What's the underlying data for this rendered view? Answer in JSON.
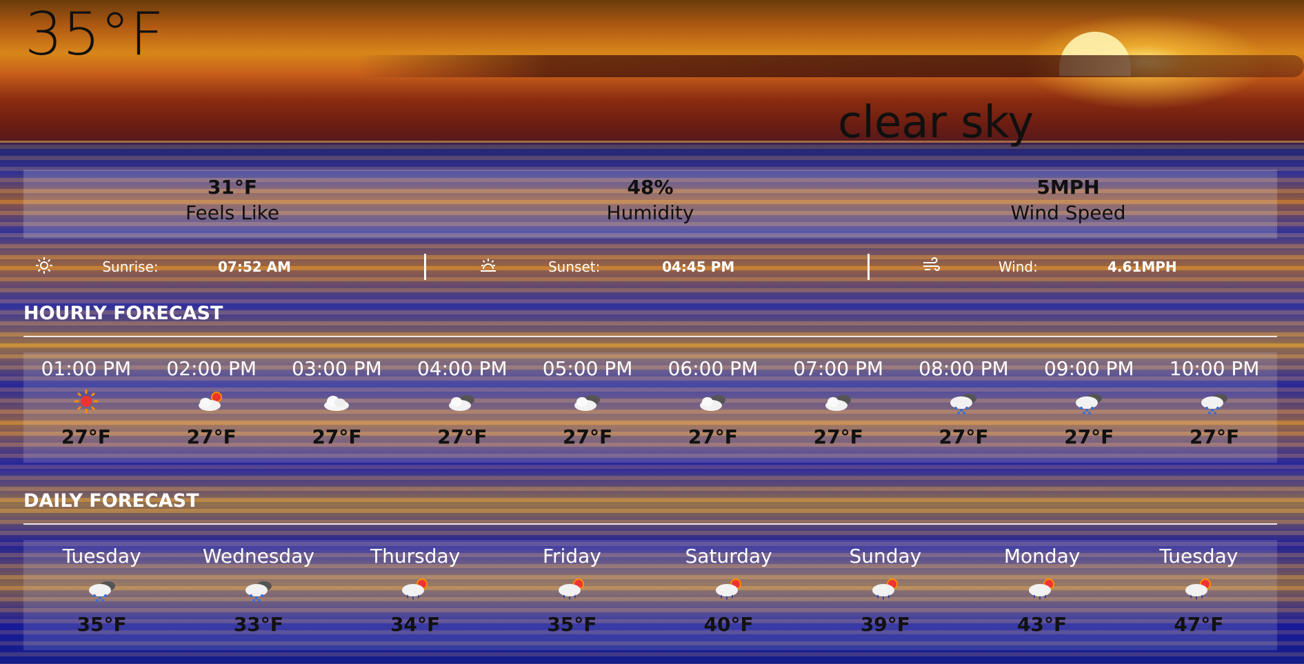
{
  "current": {
    "temperature": "35°F",
    "description": "clear sky"
  },
  "stats": [
    {
      "value": "31°F",
      "label": "Feels Like"
    },
    {
      "value": "48%",
      "label": "Humidity"
    },
    {
      "value": "5MPH",
      "label": "Wind Speed"
    }
  ],
  "details": {
    "sunrise": {
      "icon": "sun-icon",
      "label": "Sunrise:",
      "value": "07:52 AM"
    },
    "sunset": {
      "icon": "sunset-icon",
      "label": "Sunset:",
      "value": "04:45 PM"
    },
    "wind": {
      "icon": "wind-icon",
      "label": "Wind:",
      "value": "4.61MPH"
    }
  },
  "hourly": {
    "title": "HOURLY FORECAST",
    "items": [
      {
        "time": "01:00 PM",
        "icon": "sunny-icon",
        "temp": "27°F"
      },
      {
        "time": "02:00 PM",
        "icon": "partly-sunny-icon",
        "temp": "27°F"
      },
      {
        "time": "03:00 PM",
        "icon": "cloud-icon",
        "temp": "27°F"
      },
      {
        "time": "04:00 PM",
        "icon": "cloudy-icon",
        "temp": "27°F"
      },
      {
        "time": "05:00 PM",
        "icon": "cloudy-icon",
        "temp": "27°F"
      },
      {
        "time": "06:00 PM",
        "icon": "cloudy-icon",
        "temp": "27°F"
      },
      {
        "time": "07:00 PM",
        "icon": "cloudy-icon",
        "temp": "27°F"
      },
      {
        "time": "08:00 PM",
        "icon": "snow-cloud-icon",
        "temp": "27°F"
      },
      {
        "time": "09:00 PM",
        "icon": "snow-cloud-icon",
        "temp": "27°F"
      },
      {
        "time": "10:00 PM",
        "icon": "snow-cloud-icon",
        "temp": "27°F"
      }
    ]
  },
  "daily": {
    "title": "DAILY FORECAST",
    "items": [
      {
        "day": "Tuesday",
        "icon": "snow-cloud-icon",
        "temp": "35°F"
      },
      {
        "day": "Wednesday",
        "icon": "snow-cloud-icon",
        "temp": "33°F"
      },
      {
        "day": "Thursday",
        "icon": "rain-sun-icon",
        "temp": "34°F"
      },
      {
        "day": "Friday",
        "icon": "rain-sun-icon",
        "temp": "35°F"
      },
      {
        "day": "Saturday",
        "icon": "rain-sun-icon",
        "temp": "40°F"
      },
      {
        "day": "Sunday",
        "icon": "rain-sun-icon",
        "temp": "39°F"
      },
      {
        "day": "Monday",
        "icon": "rain-sun-icon",
        "temp": "43°F"
      },
      {
        "day": "Tuesday",
        "icon": "rain-sun-icon",
        "temp": "47°F"
      }
    ]
  }
}
